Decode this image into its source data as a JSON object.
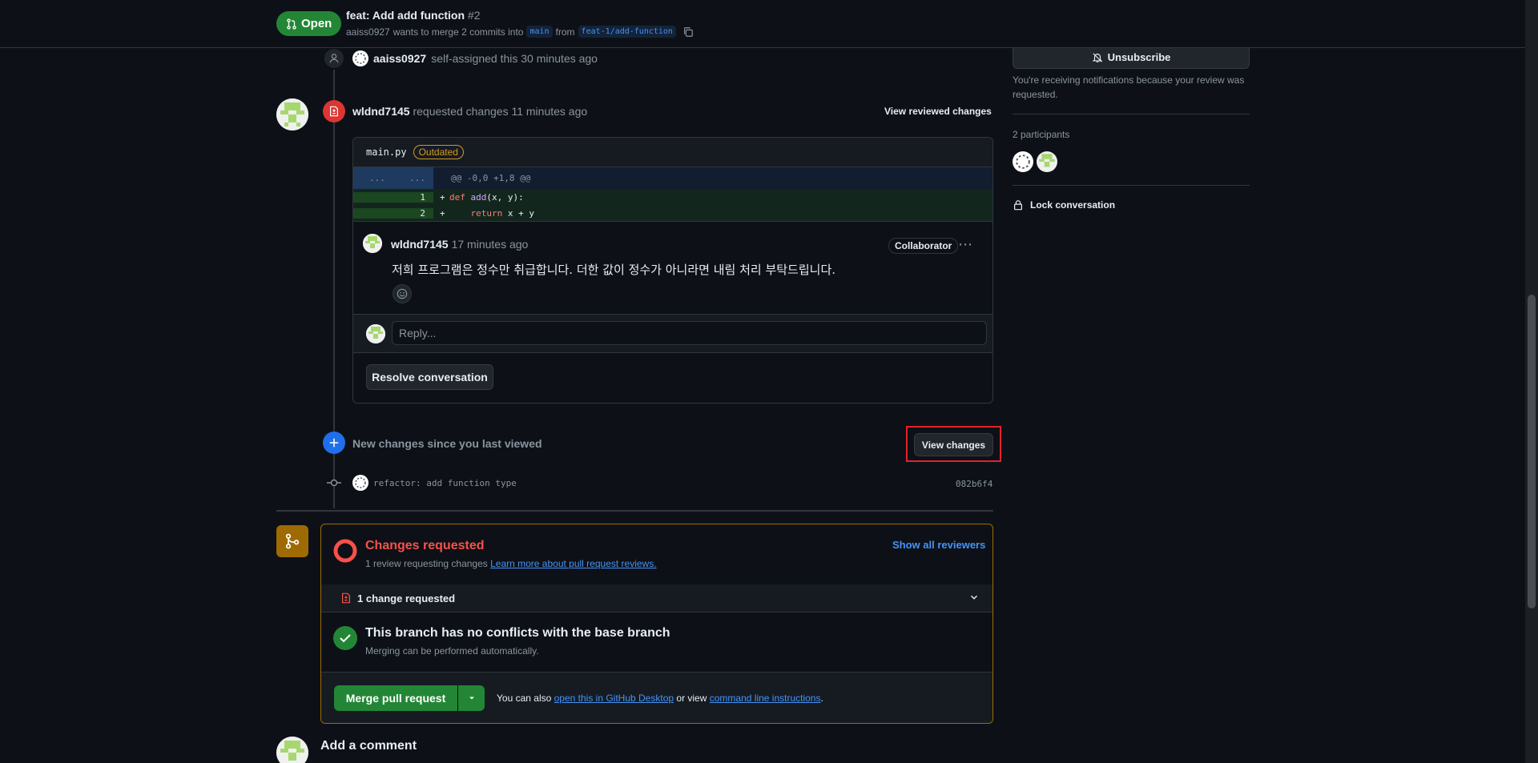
{
  "header": {
    "state": "Open",
    "title": "feat: Add add function",
    "number": "#2",
    "author": "aaiss0927",
    "merge_text": "wants to merge 2 commits into",
    "base_branch": "main",
    "from_text": "from",
    "head_branch": "feat-1/add-function"
  },
  "timeline": {
    "assign": {
      "user": "aaiss0927",
      "text": "self-assigned this 30 minutes ago"
    },
    "review": {
      "user": "wldnd7145",
      "text": "requested changes 11 minutes ago",
      "view_reviewed": "View reviewed changes",
      "file": "main.py",
      "outdated": "Outdated",
      "hunk_left": "...",
      "hunk_right": "...",
      "hunk": "@@ -0,0 +1,8 @@",
      "lines": [
        {
          "num": "1",
          "sign": "+",
          "kw": "def",
          "fn": "add",
          "rest": "(x, y):"
        },
        {
          "num": "2",
          "sign": "+",
          "indent": "    ",
          "kw": "return",
          "rest": " x + y"
        }
      ],
      "comment_author": "wldnd7145",
      "comment_time": "17 minutes ago",
      "comment_role": "Collaborator",
      "comment_body": "저희 프로그램은 정수만 취급합니다. 더한 값이 정수가 아니라면 내림 처리 부탁드립니다.",
      "reply_placeholder": "Reply...",
      "resolve_label": "Resolve conversation"
    },
    "new_changes": "New changes since you last viewed",
    "view_changes": "View changes",
    "commit_message": "refactor: add function type",
    "commit_sha": "082b6f4"
  },
  "merge_box": {
    "title": "Changes requested",
    "sub": "1 review requesting changes",
    "learn_more": "Learn more about pull request reviews.",
    "show_all": "Show all reviewers",
    "change_count": "1 change requested",
    "no_conflict_title": "This branch has no conflicts with the base branch",
    "no_conflict_sub": "Merging can be performed automatically.",
    "merge_label": "Merge pull request",
    "also_text": "You can also",
    "desktop_link": "open this in GitHub Desktop",
    "or_view": "or view",
    "cli_link": "command line instructions",
    "period": "."
  },
  "add_comment": "Add a comment",
  "sidebar": {
    "unsubscribe": "Unsubscribe",
    "notification": "You're receiving notifications because your review was requested.",
    "participants": "2 participants",
    "lock": "Lock conversation"
  },
  "colors": {
    "bg": "#0d1117",
    "open_green": "#238636",
    "changes_red": "#f85149",
    "merge_orange": "#9e6a03",
    "link_blue": "#4493f8",
    "highlight_red": "#e5212a"
  }
}
